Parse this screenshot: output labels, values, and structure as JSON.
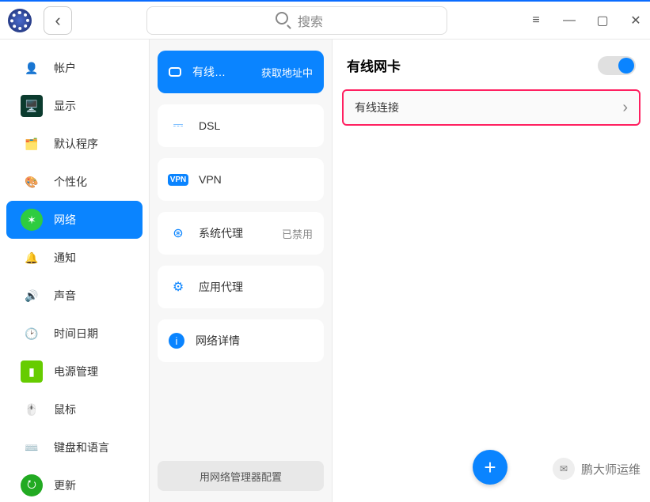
{
  "header": {
    "search_placeholder": "搜索"
  },
  "sidebar": {
    "items": [
      {
        "icon": "account-icon",
        "label": "帐户"
      },
      {
        "icon": "display-icon",
        "label": "显示"
      },
      {
        "icon": "default-apps-icon",
        "label": "默认程序"
      },
      {
        "icon": "personalization-icon",
        "label": "个性化"
      },
      {
        "icon": "network-icon",
        "label": "网络"
      },
      {
        "icon": "notifications-icon",
        "label": "通知"
      },
      {
        "icon": "sound-icon",
        "label": "声音"
      },
      {
        "icon": "datetime-icon",
        "label": "时间日期"
      },
      {
        "icon": "power-icon",
        "label": "电源管理"
      },
      {
        "icon": "mouse-icon",
        "label": "鼠标"
      },
      {
        "icon": "keyboard-icon",
        "label": "键盘和语言"
      },
      {
        "icon": "update-icon",
        "label": "更新"
      }
    ]
  },
  "mid": {
    "items": [
      {
        "icon": "wired-icon",
        "label": "有线…",
        "status": "获取地址中"
      },
      {
        "icon": "dsl-icon",
        "label": "DSL",
        "status": ""
      },
      {
        "icon": "vpn-icon",
        "label": "VPN",
        "status": ""
      },
      {
        "icon": "system-proxy-icon",
        "label": "系统代理",
        "status": "已禁用"
      },
      {
        "icon": "app-proxy-icon",
        "label": "应用代理",
        "status": ""
      },
      {
        "icon": "network-info-icon",
        "label": "网络详情",
        "status": ""
      }
    ],
    "bottom_button": "用网络管理器配置"
  },
  "detail": {
    "title": "有线网卡",
    "connection": "有线连接"
  },
  "watermark": {
    "text": "鹏大师运维"
  }
}
